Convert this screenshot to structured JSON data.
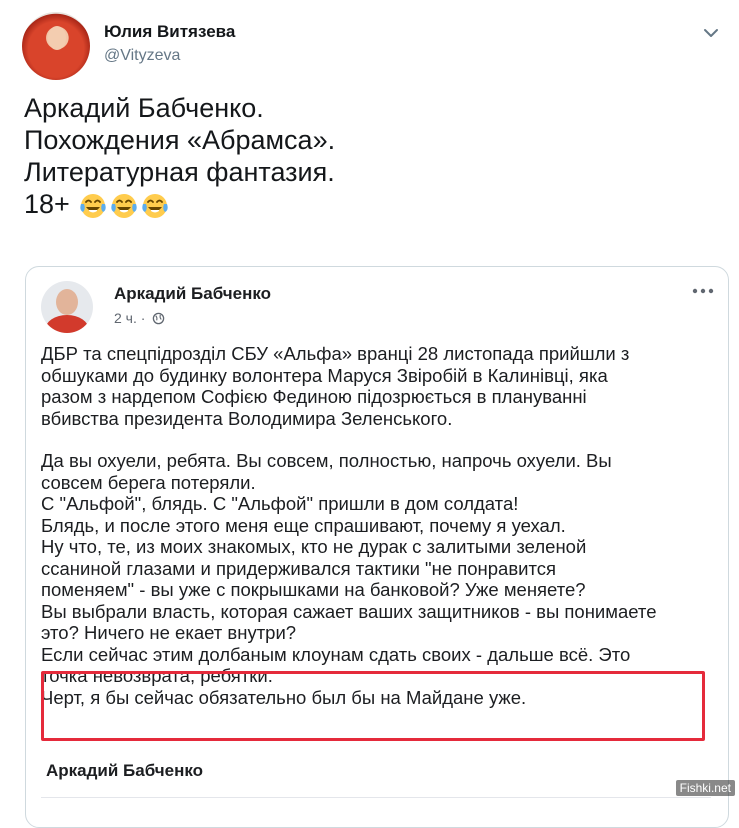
{
  "tweet": {
    "display_name": "Юлия Витязева",
    "handle": "@Vityzeva",
    "lines": [
      "Аркадий Бабченко.",
      "Похождения «Абрамса».",
      "Литературная фантазия.",
      "18+"
    ],
    "emoji_count": 3,
    "emoji_name": "face-with-tears-of-joy-icon"
  },
  "embedded_post": {
    "author": "Аркадий Бабченко",
    "time": "2 ч. ·",
    "paragraph1": [
      "ДБР та  спецпідрозділ СБУ «Альфа» вранці 28 листопада прийшли з",
      "обшуками до будинку волонтера Маруся Звіробій  в Калинівці, яка",
      "разом з нардепом Софією Фединою підозрюється в плануванні",
      "вбивства президента Володимира Зеленського."
    ],
    "paragraph2": [
      "Да вы охуели, ребята. Вы совсем, полностью, напрочь охуели. Вы",
      "совсем берега потеряли.",
      "С \"Альфой\", блядь. С \"Альфой\" пришли в дом солдата!",
      "Блядь, и после этого меня еще спрашивают, почему я уехал.",
      "Ну что, те, из моих знакомых, кто не дурак с залитыми зеленой",
      "ссаниной глазами и придерживался тактики \"не понравится",
      "поменяем\" - вы уже с покрышками на банковой? Уже меняете?",
      "Вы выбрали власть, которая сажает ваших защитников - вы понимаете",
      "это? Ничего не екает внутри?"
    ],
    "highlighted": [
      "Если сейчас этим долбаным клоунам сдать своих - дальше всё. Это",
      "точка невозврата, ребятки.",
      "Черт, я бы сейчас обязательно был бы на Майдане уже."
    ],
    "footer_author": "Аркадий Бабченко",
    "highlight_color": "#e52a3b"
  },
  "watermark": "Fishki.net"
}
